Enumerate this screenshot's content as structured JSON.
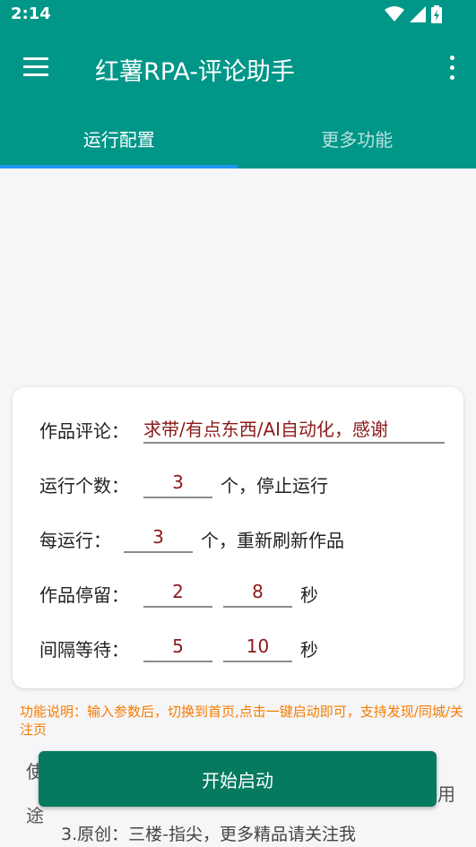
{
  "status_bar": {
    "time": "2:14"
  },
  "app_bar": {
    "title": "红薯RPA-评论助手"
  },
  "tabs": [
    {
      "label": "运行配置",
      "active": true
    },
    {
      "label": "更多功能",
      "active": false
    }
  ],
  "form": {
    "comment_label": "作品评论：",
    "comment_value": "求带/有点东西/AI自动化，感谢",
    "run_count_label": "运行个数：",
    "run_count_value": "3",
    "run_count_suffix": "个，停止运行",
    "refresh_label": "每运行：",
    "refresh_value": "3",
    "refresh_suffix": "个，重新刷新作品",
    "stay_label": "作品停留：",
    "stay_min": "2",
    "stay_max": "8",
    "stay_unit": "秒",
    "interval_label": "间隔等待：",
    "interval_min": "5",
    "interval_max": "10",
    "interval_unit": "秒"
  },
  "description": "功能说明：输入参数后，切换到首页,点击一键启动即可，支持发现/同城/关注页",
  "behind_text": {
    "left_1": "使",
    "left_2": "途",
    "right": "用"
  },
  "start_button": "开始启动",
  "footer_line": "3.原创：三楼-指尖，更多精品请关注我",
  "colors": {
    "primary": "#009688",
    "accent": "#2196f3",
    "button": "#057a5f",
    "input_text": "#8b1a1a",
    "note": "#f57c00"
  }
}
